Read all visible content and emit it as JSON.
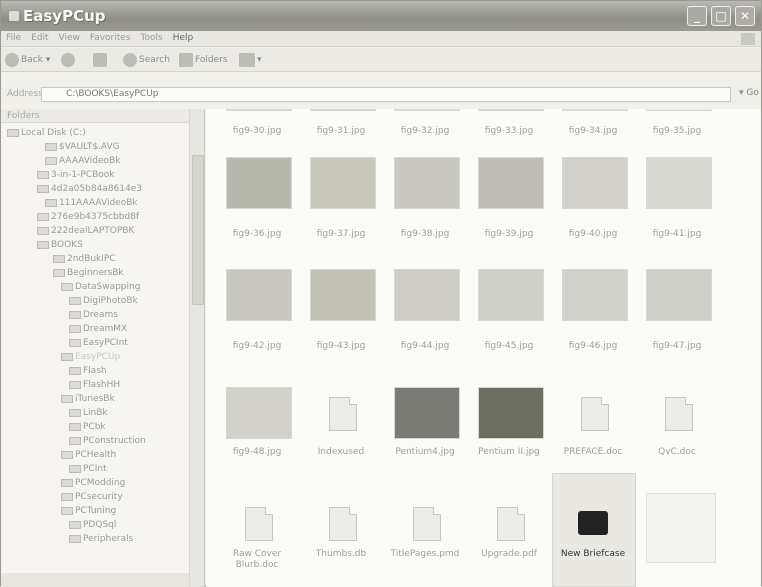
{
  "window": {
    "title": "EasyPCup"
  },
  "menu": [
    "File",
    "Edit",
    "View",
    "Favorites",
    "Tools",
    "Help"
  ],
  "toolbar": {
    "back": "Back",
    "search": "Search",
    "folders": "Folders"
  },
  "address": {
    "label": "Address",
    "value": "C:\\BOOKS\\EasyPCUp",
    "go": "Go"
  },
  "folders_pane": {
    "title": "Folders",
    "items": [
      {
        "label": "Local Disk (C:)"
      },
      {
        "label": "$VAULT$.AVG"
      },
      {
        "label": "AAAAVideoBk"
      },
      {
        "label": "3-in-1-PCBook"
      },
      {
        "label": "4d2a05b84a8614e3"
      },
      {
        "label": "111AAAAVideoBk"
      },
      {
        "label": "276e9b4375cbbd8f"
      },
      {
        "label": "222dealLAPTOPBK"
      },
      {
        "label": "BOOKS"
      },
      {
        "label": "2ndBukIPC"
      },
      {
        "label": "BeginnersBk"
      },
      {
        "label": "DataSwapping"
      },
      {
        "label": "DigiPhotoBk"
      },
      {
        "label": "Dreams"
      },
      {
        "label": "DreamMX"
      },
      {
        "label": "EasyPCInt"
      },
      {
        "label": "EasyPCUp"
      },
      {
        "label": "Flash"
      },
      {
        "label": "FlashHH"
      },
      {
        "label": "iTunesBk"
      },
      {
        "label": "LinBk"
      },
      {
        "label": "PCbk"
      },
      {
        "label": "PConstruction"
      },
      {
        "label": "PCHealth"
      },
      {
        "label": "PCInt"
      },
      {
        "label": "PCModding"
      },
      {
        "label": "PCsecurity"
      },
      {
        "label": "PCTuning"
      },
      {
        "label": "PDQSql"
      },
      {
        "label": "Peripherals"
      }
    ]
  },
  "files": {
    "row1": [
      "fig9-30.jpg",
      "fig9-31.jpg",
      "fig9-32.jpg",
      "fig9-33.jpg",
      "fig9-34.jpg",
      "fig9-35.jpg"
    ],
    "row2": [
      "fig9-36.jpg",
      "fig9-37.jpg",
      "fig9-38.jpg",
      "fig9-39.jpg",
      "fig9-40.jpg",
      "fig9-41.jpg"
    ],
    "row3": [
      "fig9-42.jpg",
      "fig9-43.jpg",
      "fig9-44.jpg",
      "fig9-45.jpg",
      "fig9-46.jpg",
      "fig9-47.jpg"
    ],
    "row4": [
      "fig9-48.jpg",
      "Indexused",
      "Pentium4.jpg",
      "Pentium II.jpg",
      "PREFACE.doc",
      "QvC.doc"
    ],
    "row5": [
      "Raw Cover Blurb.doc",
      "Thumbs.db",
      "TitlePages.pmd",
      "Upgrade.pdf",
      "New Briefcase",
      ""
    ]
  }
}
